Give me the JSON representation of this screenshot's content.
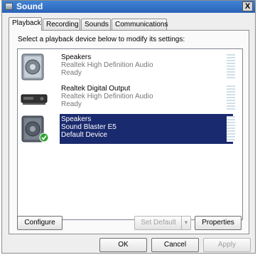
{
  "window": {
    "title": "Sound",
    "close_glyph": "X"
  },
  "tabs": [
    {
      "label": "Playback",
      "active": true
    },
    {
      "label": "Recording",
      "active": false
    },
    {
      "label": "Sounds",
      "active": false
    },
    {
      "label": "Communications",
      "active": false
    }
  ],
  "playback": {
    "instruction": "Select a playback device below to modify its settings:",
    "devices": [
      {
        "name": "Speakers",
        "driver": "Realtek High Definition Audio",
        "status": "Ready",
        "icon": "speakers-icon",
        "selected": false
      },
      {
        "name": "Realtek Digital Output",
        "driver": "Realtek High Definition Audio",
        "status": "Ready",
        "icon": "digital-output-icon",
        "selected": false
      },
      {
        "name": "Speakers",
        "driver": "Sound Blaster E5",
        "status": "Default Device",
        "icon": "speakers-default-icon",
        "selected": true
      }
    ],
    "configure_label": "Configure",
    "set_default_label": "Set Default",
    "properties_label": "Properties"
  },
  "footer": {
    "ok_label": "OK",
    "cancel_label": "Cancel",
    "apply_label": "Apply"
  },
  "colors": {
    "selection": "#1a2a6e",
    "title_bar": "#2a63b8",
    "default_check": "#2fa52f"
  }
}
